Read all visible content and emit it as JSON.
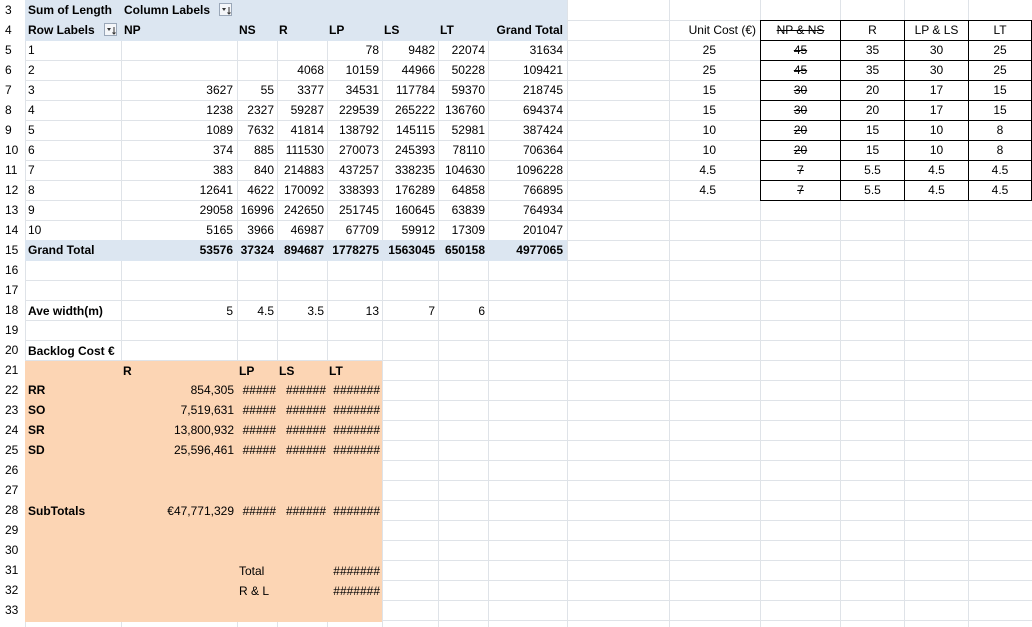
{
  "row_numbers": [
    "3",
    "4",
    "5",
    "6",
    "7",
    "8",
    "9",
    "10",
    "11",
    "12",
    "13",
    "14",
    "15",
    "16",
    "17",
    "18",
    "19",
    "20",
    "21",
    "22",
    "23",
    "24",
    "25",
    "26",
    "27",
    "28",
    "29",
    "30",
    "31",
    "32",
    "33"
  ],
  "pivot": {
    "value_field": "Sum of Length",
    "column_labels": "Column Labels",
    "row_labels": "Row Labels",
    "col_headers": [
      "NP",
      "NS",
      "R",
      "LP",
      "LS",
      "LT",
      "Grand Total"
    ],
    "rows": [
      {
        "label": "1",
        "np": "",
        "ns": "",
        "r": "",
        "lp": "78",
        "ls": "9482",
        "lt": "22074",
        "gt": "31634"
      },
      {
        "label": "2",
        "np": "",
        "ns": "",
        "r": "4068",
        "lp": "10159",
        "ls": "44966",
        "lt": "50228",
        "gt": "109421"
      },
      {
        "label": "3",
        "np": "3627",
        "ns": "55",
        "r": "3377",
        "lp": "34531",
        "ls": "117784",
        "lt": "59370",
        "gt": "218745"
      },
      {
        "label": "4",
        "np": "1238",
        "ns": "2327",
        "r": "59287",
        "lp": "229539",
        "ls": "265222",
        "lt": "136760",
        "gt": "694374"
      },
      {
        "label": "5",
        "np": "1089",
        "ns": "7632",
        "r": "41814",
        "lp": "138792",
        "ls": "145115",
        "lt": "52981",
        "gt": "387424"
      },
      {
        "label": "6",
        "np": "374",
        "ns": "885",
        "r": "111530",
        "lp": "270073",
        "ls": "245393",
        "lt": "78110",
        "gt": "706364"
      },
      {
        "label": "7",
        "np": "383",
        "ns": "840",
        "r": "214883",
        "lp": "437257",
        "ls": "338235",
        "lt": "104630",
        "gt": "1096228"
      },
      {
        "label": "8",
        "np": "12641",
        "ns": "4622",
        "r": "170092",
        "lp": "338393",
        "ls": "176289",
        "lt": "64858",
        "gt": "766895"
      },
      {
        "label": "9",
        "np": "29058",
        "ns": "16996",
        "r": "242650",
        "lp": "251745",
        "ls": "160645",
        "lt": "63839",
        "gt": "764934"
      },
      {
        "label": "10",
        "np": "5165",
        "ns": "3966",
        "r": "46987",
        "lp": "67709",
        "ls": "59912",
        "lt": "17309",
        "gt": "201047"
      }
    ],
    "grand_total": {
      "label": "Grand Total",
      "np": "53576",
      "ns": "37324",
      "r": "894687",
      "lp": "1778275",
      "ls": "1563045",
      "lt": "650158",
      "gt": "4977065"
    }
  },
  "ave_width": {
    "label": "Ave width(m)",
    "np": "5",
    "ns": "4.5",
    "r": "3.5",
    "lp": "13",
    "ls": "7",
    "lt": "6"
  },
  "backlog": {
    "title": "Backlog Cost €",
    "headers": {
      "r": "R",
      "lp": "LP",
      "ls": "LS",
      "lt": "LT"
    },
    "rows": [
      {
        "label": "RR",
        "r": "854,305",
        "lp": "#####",
        "ls": "######",
        "lt": "#######"
      },
      {
        "label": "SO",
        "r": "7,519,631",
        "lp": "#####",
        "ls": "######",
        "lt": "#######"
      },
      {
        "label": "SR",
        "r": "13,800,932",
        "lp": "#####",
        "ls": "######",
        "lt": "#######"
      },
      {
        "label": "SD",
        "r": "25,596,461",
        "lp": "#####",
        "ls": "######",
        "lt": "#######"
      }
    ],
    "subtotals": {
      "label": "SubTotals",
      "r": "€47,771,329",
      "lp": "#####",
      "ls": "######",
      "lt": "#######"
    },
    "total": {
      "label": "Total",
      "value": "#######"
    },
    "rl": {
      "label": "R & L",
      "value": "#######"
    }
  },
  "unit_cost": {
    "label": "Unit Cost (€)",
    "headers": [
      "NP & NS",
      "R",
      "LP & LS",
      "LT"
    ],
    "rows": [
      {
        "uc": "25",
        "npns": "45",
        "r": "35",
        "lpls": "30",
        "lt": "25"
      },
      {
        "uc": "25",
        "npns": "45",
        "r": "35",
        "lpls": "30",
        "lt": "25"
      },
      {
        "uc": "15",
        "npns": "30",
        "r": "20",
        "lpls": "17",
        "lt": "15"
      },
      {
        "uc": "15",
        "npns": "30",
        "r": "20",
        "lpls": "17",
        "lt": "15"
      },
      {
        "uc": "10",
        "npns": "20",
        "r": "15",
        "lpls": "10",
        "lt": "8"
      },
      {
        "uc": "10",
        "npns": "20",
        "r": "15",
        "lpls": "10",
        "lt": "8"
      },
      {
        "uc": "4.5",
        "npns": "7",
        "r": "5.5",
        "lpls": "4.5",
        "lt": "4.5"
      },
      {
        "uc": "4.5",
        "npns": "7",
        "r": "5.5",
        "lpls": "4.5",
        "lt": "4.5"
      }
    ]
  }
}
